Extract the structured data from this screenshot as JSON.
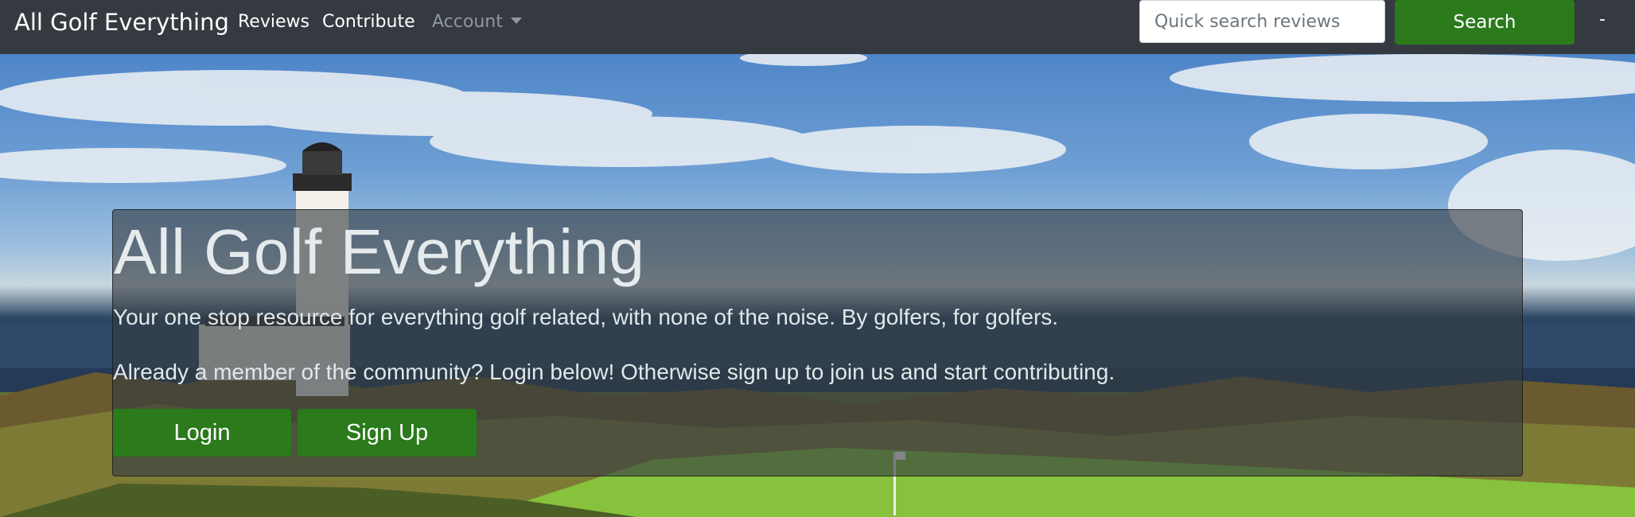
{
  "navbar": {
    "brand": "All Golf Everything",
    "links": [
      {
        "label": "Reviews"
      },
      {
        "label": "Contribute"
      },
      {
        "label": "Account"
      }
    ],
    "search": {
      "placeholder": "Quick search reviews",
      "value": "",
      "button_label": "Search"
    },
    "user_menu_label": "-"
  },
  "hero": {
    "title": "All Golf Everything",
    "tagline": "Your one stop resource for everything golf related, with none of the noise. By golfers, for golfers.",
    "prompt": "Already a member of the community? Login below! Otherwise sign up to join us and start contributing.",
    "buttons": {
      "login": "Login",
      "signup": "Sign Up"
    }
  },
  "colors": {
    "navbar_bg": "#343a40",
    "button_green": "#2b7a1c",
    "jumbotron_overlay": "rgba(52,58,64,0.62)"
  }
}
